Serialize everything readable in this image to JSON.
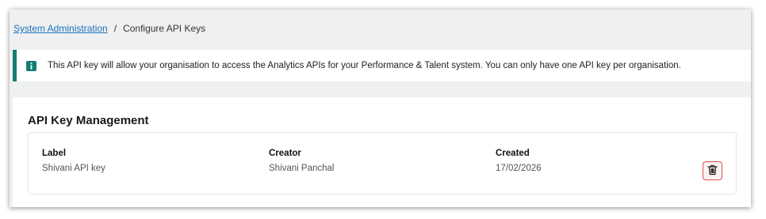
{
  "breadcrumb": {
    "parent": "System Administration",
    "separator": "/",
    "current": "Configure API Keys"
  },
  "info_banner": {
    "icon": "info-icon",
    "text": "This API key will allow your organisation to access the Analytics APIs for your Performance & Talent system. You can only have one API key per organisation."
  },
  "card": {
    "title": "API Key Management",
    "columns": {
      "label": "Label",
      "creator": "Creator",
      "created": "Created"
    },
    "rows": [
      {
        "label": "Shivani API key",
        "creator": "Shivani Panchal",
        "created": "17/02/2026",
        "delete_icon": "trash-icon"
      }
    ]
  },
  "colors": {
    "link": "#1d72b8",
    "accent": "#137d73",
    "danger": "#d9534f",
    "background": "#eef0f2"
  }
}
